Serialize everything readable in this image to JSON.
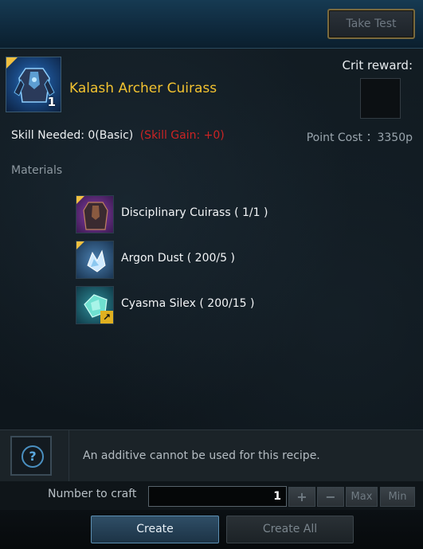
{
  "header": {
    "take_test_label": "Take Test"
  },
  "item": {
    "name": "Kalash Archer Cuirass",
    "count": "1",
    "icon": "armor-cuirass-icon"
  },
  "crit": {
    "label": "Crit reward:"
  },
  "skill": {
    "needed": "Skill Needed: 0(Basic)",
    "gain": "(Skill Gain:  +0)"
  },
  "cost": {
    "text": "Point Cost ：3350p"
  },
  "materials": {
    "label": "Materials",
    "items": [
      {
        "name": "Disciplinary Cuirass ( 1/1 )",
        "icon": "cuirass-icon"
      },
      {
        "name": "Argon Dust ( 200/5 )",
        "icon": "crystal-dust-icon"
      },
      {
        "name": "Cyasma Silex ( 200/15 )",
        "icon": "gem-icon"
      }
    ]
  },
  "notice": {
    "text": "An additive cannot be used for this recipe."
  },
  "craft": {
    "label": "Number to craft",
    "quantity": "1",
    "plus": "+",
    "minus": "−",
    "max": "Max",
    "min": "Min"
  },
  "actions": {
    "create": "Create",
    "create_all": "Create All"
  },
  "colors": {
    "item_name": "#f2c230",
    "skill_gain": "#cc2424"
  }
}
